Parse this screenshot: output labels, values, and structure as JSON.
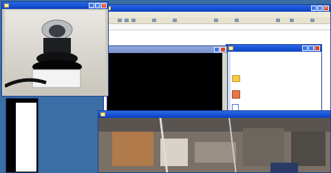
{
  "camera_window": {
    "title": "",
    "buttons": {
      "minimize": "_",
      "maximize": "□",
      "close": "×"
    }
  },
  "word_window": {
    "title": "",
    "menu": "",
    "buttons": {
      "minimize": "_",
      "maximize": "□",
      "close": "×"
    }
  },
  "dark_window": {
    "title": "",
    "buttons": {
      "minimize": "_",
      "maximize": "□",
      "close": "×"
    }
  },
  "explorer_window": {
    "title": "",
    "items": [
      {
        "label": "",
        "icon": "folder-icon"
      },
      {
        "label": "",
        "icon": "image-file-icon"
      },
      {
        "label": "",
        "icon": "document-icon"
      }
    ]
  },
  "document_pane": {
    "lines": [
      "",
      "",
      ""
    ]
  },
  "overview_window": {
    "title": ""
  },
  "colors": {
    "titlebar_active": "#0a3fc0",
    "titlebar_inactive": "#7a90cc",
    "desktop": "#3a6ea5"
  }
}
